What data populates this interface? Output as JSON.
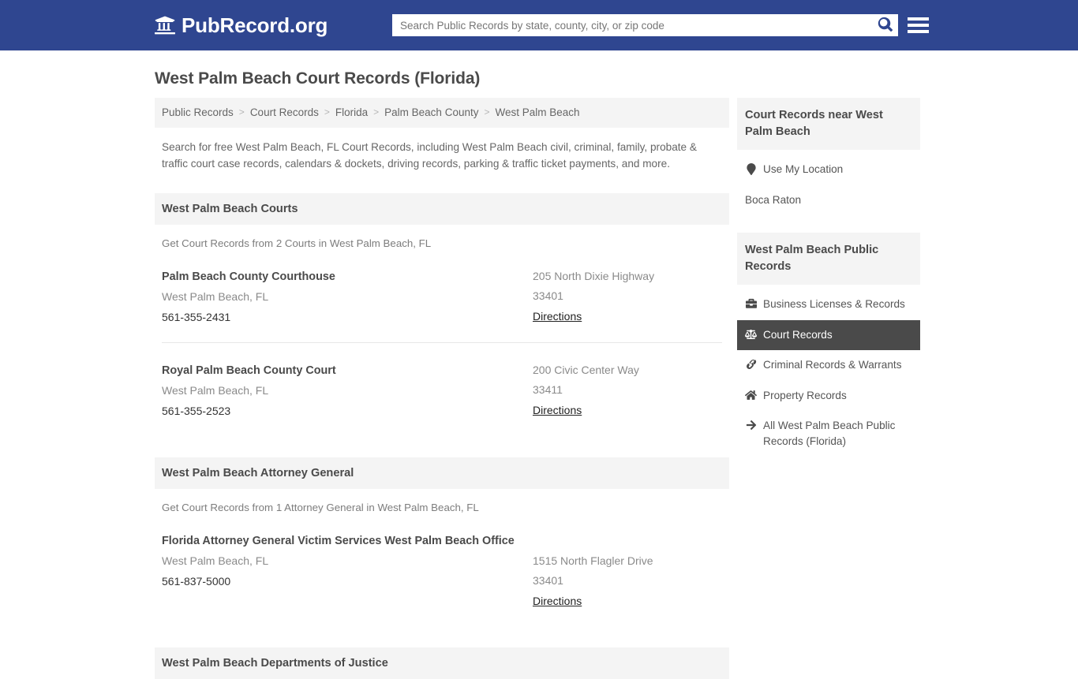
{
  "header": {
    "brand_name": "PubRecord.org",
    "brand_icon": "university-icon",
    "search_placeholder": "Search Public Records by state, county, city, or zip code",
    "search_value": "",
    "search_icon": "search-icon",
    "menu_icon": "hamburger-menu-icon"
  },
  "page": {
    "title": "West Palm Beach Court Records (Florida)",
    "intro": "Search for free West Palm Beach, FL Court Records, including West Palm Beach civil, criminal, family, probate & traffic court case records, calendars & dockets, driving records, parking & traffic ticket payments, and more."
  },
  "breadcrumb": {
    "separator": ">",
    "items": [
      {
        "label": "Public Records"
      },
      {
        "label": "Court Records"
      },
      {
        "label": "Florida"
      },
      {
        "label": "Palm Beach County"
      },
      {
        "label": "West Palm Beach"
      }
    ]
  },
  "sections": [
    {
      "heading": "West Palm Beach Courts",
      "subtitle": "Get Court Records from 2 Courts in West Palm Beach, FL",
      "listings": [
        {
          "name": "Palm Beach County Courthouse",
          "city": "West Palm Beach, FL",
          "phone": "561-355-2431",
          "street": "205 North Dixie Highway",
          "zip": "33401",
          "directions": "Directions"
        },
        {
          "name": "Royal Palm Beach County Court",
          "city": "West Palm Beach, FL",
          "phone": "561-355-2523",
          "street": "200 Civic Center Way",
          "zip": "33411",
          "directions": "Directions"
        }
      ]
    },
    {
      "heading": "West Palm Beach Attorney General",
      "subtitle": "Get Court Records from 1 Attorney General in West Palm Beach, FL",
      "listings": [
        {
          "name": "Florida Attorney General Victim Services West Palm Beach Office",
          "city": "West Palm Beach, FL",
          "phone": "561-837-5000",
          "street": "1515 North Flagler Drive",
          "zip": "33401",
          "directions": "Directions"
        }
      ]
    },
    {
      "heading": "West Palm Beach Departments of Justice",
      "subtitle": "",
      "listings": []
    }
  ],
  "sidebar": {
    "nearby": {
      "heading": "Court Records near West Palm Beach",
      "items": [
        {
          "label": "Use My Location",
          "icon": "map-pin-icon"
        },
        {
          "label": "Boca Raton",
          "icon": ""
        }
      ]
    },
    "public_records": {
      "heading": "West Palm Beach Public Records",
      "items": [
        {
          "label": "Business Licenses & Records",
          "icon": "briefcase-icon",
          "active": false
        },
        {
          "label": "Court Records",
          "icon": "balance-scale-icon",
          "active": true
        },
        {
          "label": "Criminal Records & Warrants",
          "icon": "handcuffs-icon",
          "active": false
        },
        {
          "label": "Property Records",
          "icon": "home-icon",
          "active": false
        },
        {
          "label": "All West Palm Beach Public Records (Florida)",
          "icon": "arrow-right-icon",
          "active": false
        }
      ]
    }
  },
  "colors": {
    "header_blue": "#2f4690",
    "band_gray": "#f4f4f4",
    "active_gray": "#4a4a4a",
    "body_text": "#666666"
  }
}
